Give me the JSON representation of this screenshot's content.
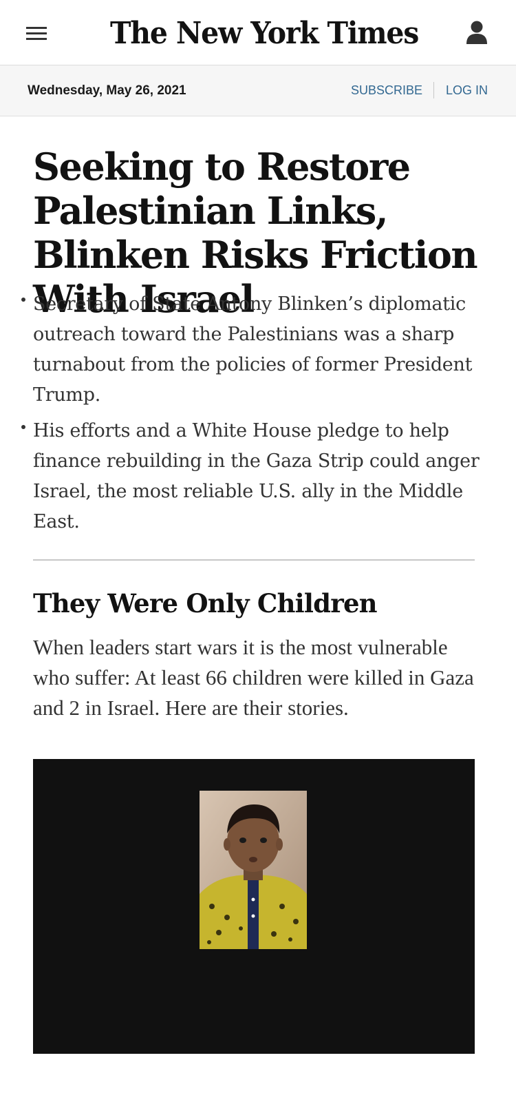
{
  "header": {
    "logo": "The New York Times",
    "menu_icon": "hamburger-menu-icon",
    "account_icon": "user-account-icon"
  },
  "datebar": {
    "date": "Wednesday, May 26, 2021",
    "subscribe": "SUBSCRIBE",
    "login": "LOG IN"
  },
  "lead_story": {
    "headline": "Seeking to Restore Palestinian Links, Blinken Risks Friction With Israel",
    "summary": [
      "Secretary of State Antony Blinken’s diplomatic outreach toward the Palestinians was a sharp turnabout from the policies of former President Trump.",
      "His efforts and a White House pledge to help finance rebuilding in the Gaza Strip could anger Israel, the most reliable U.S. ally in the Middle East."
    ]
  },
  "second_story": {
    "headline": "They Were Only Children",
    "summary": "When leaders start wars it is the most vulnerable who suffer: At least 66 children were killed in Gaza and 2 in Israel. Here are their stories."
  },
  "colors": {
    "link_blue": "#326891",
    "text_dark": "#121212",
    "text_body": "#333333",
    "datebar_bg": "#f6f6f6",
    "media_bg": "#111111"
  }
}
